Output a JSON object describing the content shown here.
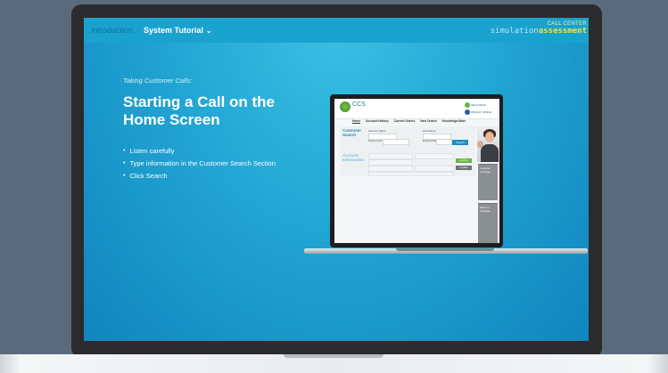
{
  "nav": {
    "intro_label": "Introduction",
    "tutorial_label": "System Tutorial",
    "chevron_icon": "chevron-down-icon"
  },
  "brand": {
    "line1": "CALL CENTER",
    "line2_a": "simulation",
    "line2_b": "assessment"
  },
  "slide": {
    "kicker": "Taking Customer Calls:",
    "title": "Starting a Call on the Home Screen",
    "bullets": [
      "Listen carefully",
      "Type information in the Customer Search Section",
      "Click Search"
    ]
  },
  "mini_app": {
    "logo": "CCS",
    "help_button": "HELP DESK",
    "privacy_button": "PRIVACY MODE",
    "tabs": [
      "Home",
      "Account History",
      "Current Orders",
      "New Orders",
      "Knowledge Base"
    ],
    "search_section": "Customer Search",
    "info_section": "Account Information",
    "fields": {
      "account_name": "Account Name",
      "last_name": "Last Name",
      "phone_last": "Phone Last",
      "email_address": "Email Address"
    },
    "search_button": "Search",
    "green_button": "Confirm",
    "grey_button": "Update",
    "panel1": "Customer message...",
    "panel2": "Reply to message..."
  }
}
